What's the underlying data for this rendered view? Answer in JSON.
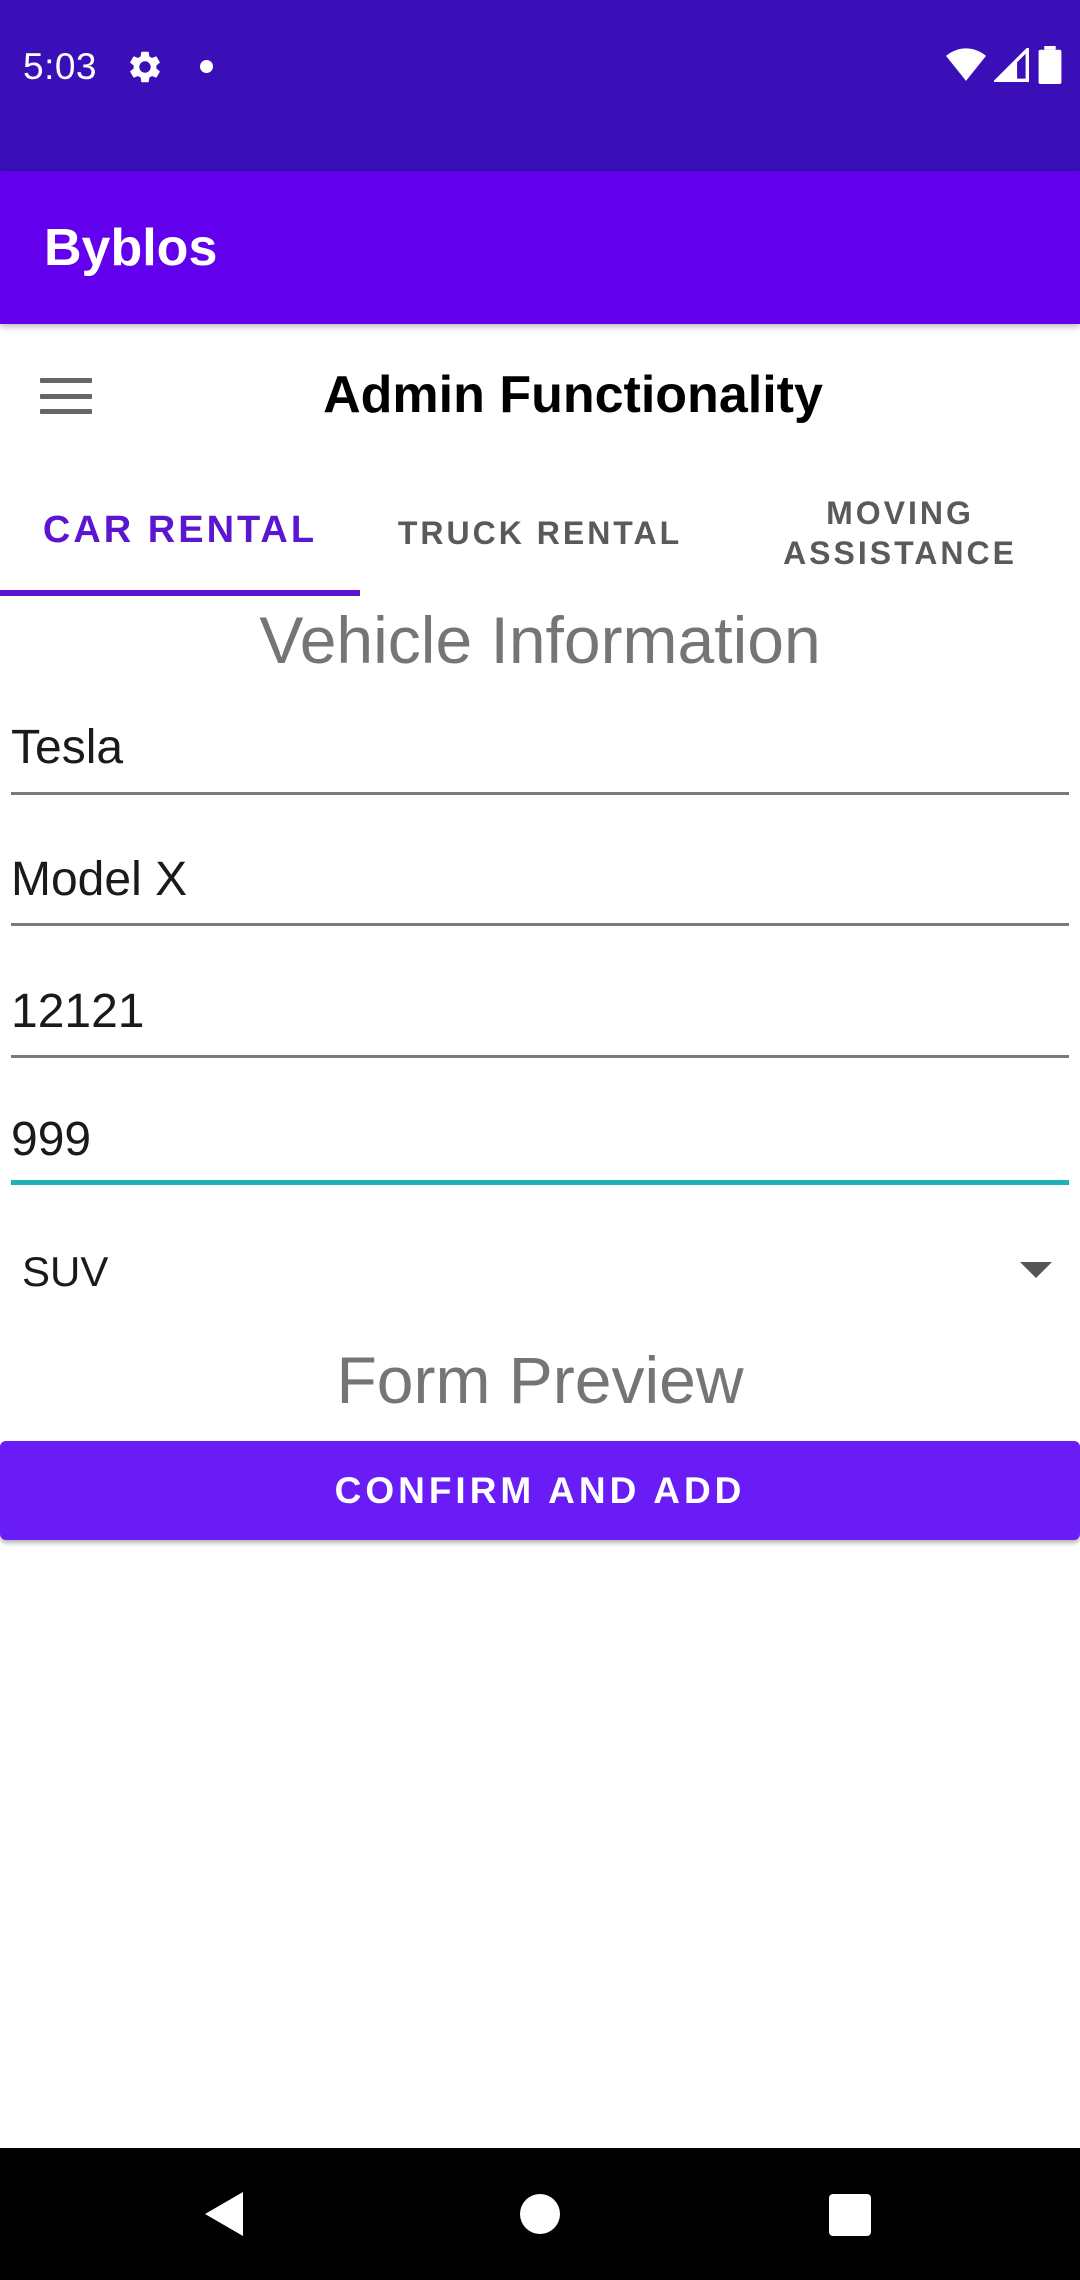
{
  "status_bar": {
    "time": "5:03",
    "icons": [
      "gear-icon",
      "notification-dot-icon",
      "wifi-icon",
      "cell-signal-icon",
      "battery-icon"
    ]
  },
  "app_bar": {
    "title": "Byblos"
  },
  "header": {
    "menu_icon": "hamburger-menu-icon",
    "title": "Admin Functionality"
  },
  "tabs": [
    {
      "label": "CAR RENTAL",
      "active": true
    },
    {
      "label": "TRUCK RENTAL",
      "active": false
    },
    {
      "label": "MOVING ASSISTANCE",
      "active": false
    }
  ],
  "form": {
    "section_title": "Vehicle Information",
    "fields": [
      {
        "value": "Tesla"
      },
      {
        "value": "Model X"
      },
      {
        "value": "12121"
      },
      {
        "value": "999",
        "focused": true
      }
    ],
    "vehicle_type": {
      "selected": "SUV"
    },
    "preview_title": "Form Preview",
    "confirm_label": "CONFIRM AND ADD"
  },
  "colors": {
    "status_bar": "#3a0fb7",
    "app_bar": "#6200ee",
    "accent": "#5b16cf",
    "focus_underline": "#1eb1b6",
    "button": "#6a1cf6"
  }
}
